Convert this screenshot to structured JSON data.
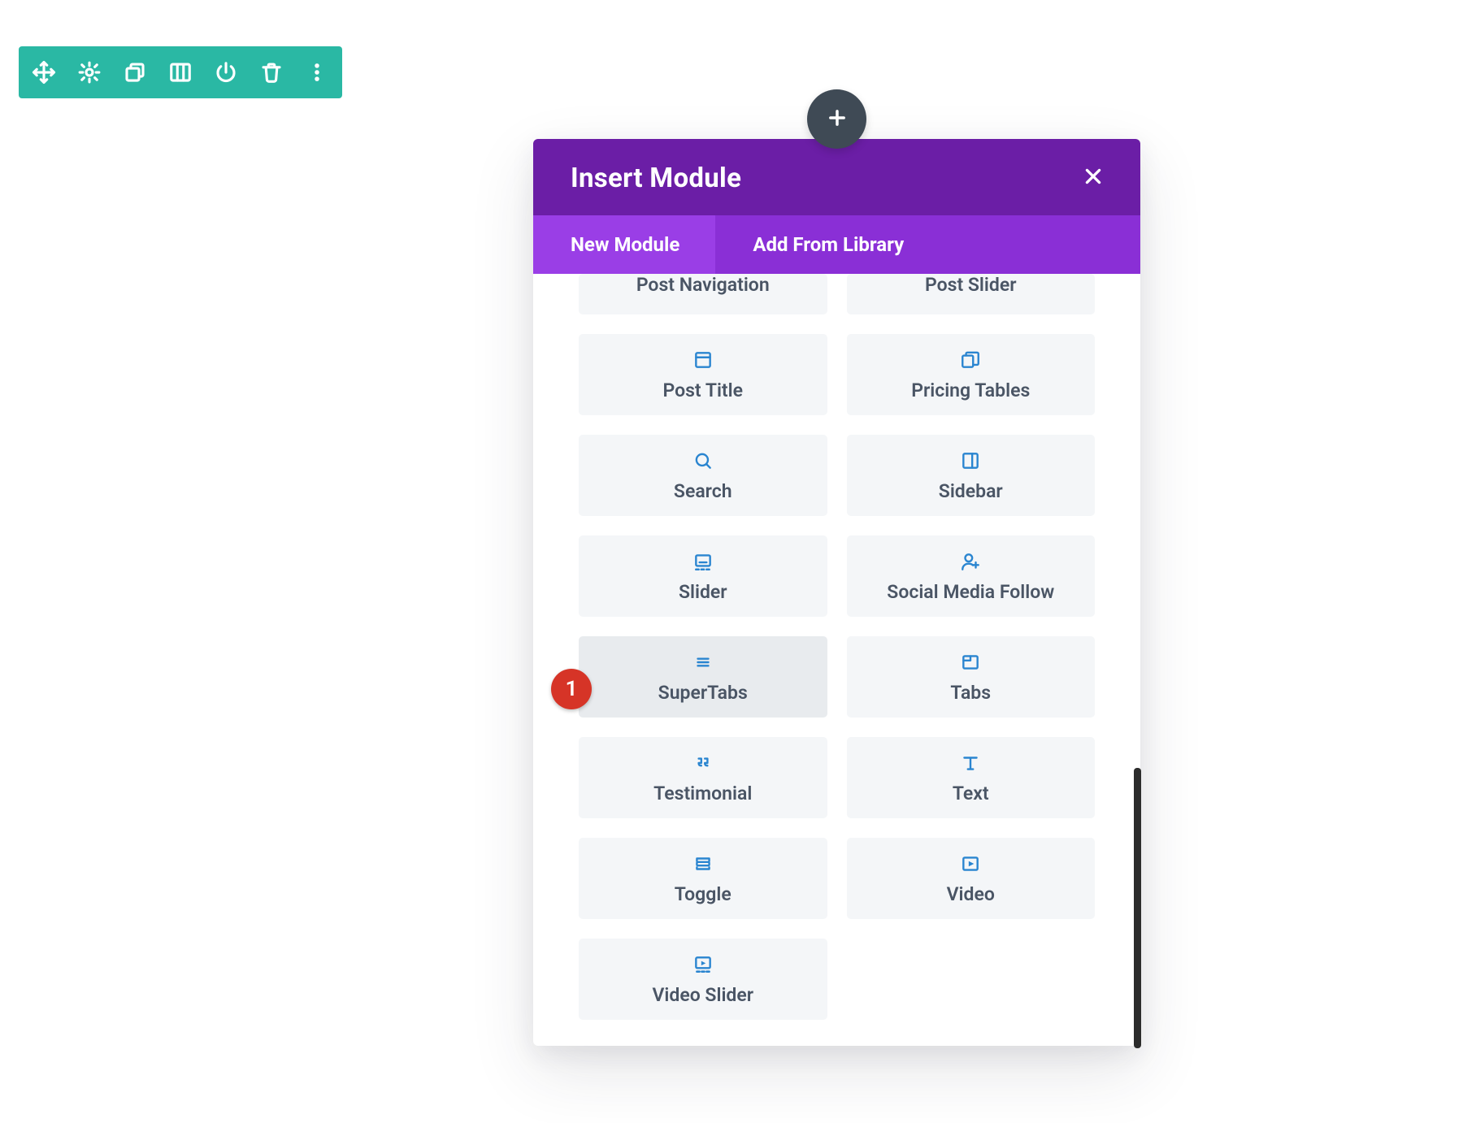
{
  "toolbar": {
    "items": [
      {
        "name": "move-icon"
      },
      {
        "name": "gear-icon"
      },
      {
        "name": "duplicate-icon"
      },
      {
        "name": "columns-icon"
      },
      {
        "name": "power-icon"
      },
      {
        "name": "trash-icon"
      },
      {
        "name": "kebab-icon"
      }
    ]
  },
  "addButton": {
    "name": "plus-icon"
  },
  "modal": {
    "title": "Insert Module",
    "close": "×",
    "tabs": [
      {
        "label": "New Module",
        "active": true
      },
      {
        "label": "Add From Library",
        "active": false
      }
    ],
    "modules": [
      {
        "label": "Post Navigation",
        "icon": "none",
        "trimmed": true
      },
      {
        "label": "Post Slider",
        "icon": "none",
        "trimmed": true
      },
      {
        "label": "Post Title",
        "icon": "window"
      },
      {
        "label": "Pricing Tables",
        "icon": "cards"
      },
      {
        "label": "Search",
        "icon": "search"
      },
      {
        "label": "Sidebar",
        "icon": "sidebar"
      },
      {
        "label": "Slider",
        "icon": "slider"
      },
      {
        "label": "Social Media Follow",
        "icon": "person-plus"
      },
      {
        "label": "SuperTabs",
        "icon": "lines",
        "selected": true
      },
      {
        "label": "Tabs",
        "icon": "tab"
      },
      {
        "label": "Testimonial",
        "icon": "quote"
      },
      {
        "label": "Text",
        "icon": "text"
      },
      {
        "label": "Toggle",
        "icon": "rows"
      },
      {
        "label": "Video",
        "icon": "play"
      },
      {
        "label": "Video Slider",
        "icon": "play-bar"
      }
    ]
  },
  "annotation": {
    "badge1": "1"
  },
  "colors": {
    "toolbar": "#2ab8a4",
    "modalHeader": "#6b1ea6",
    "modalTabs": "#8a2fd6",
    "modalTabActive": "#9a3ee6",
    "iconBlue": "#2a85d0",
    "badgeRed": "#d63427",
    "addCircle": "#3f4a55"
  }
}
